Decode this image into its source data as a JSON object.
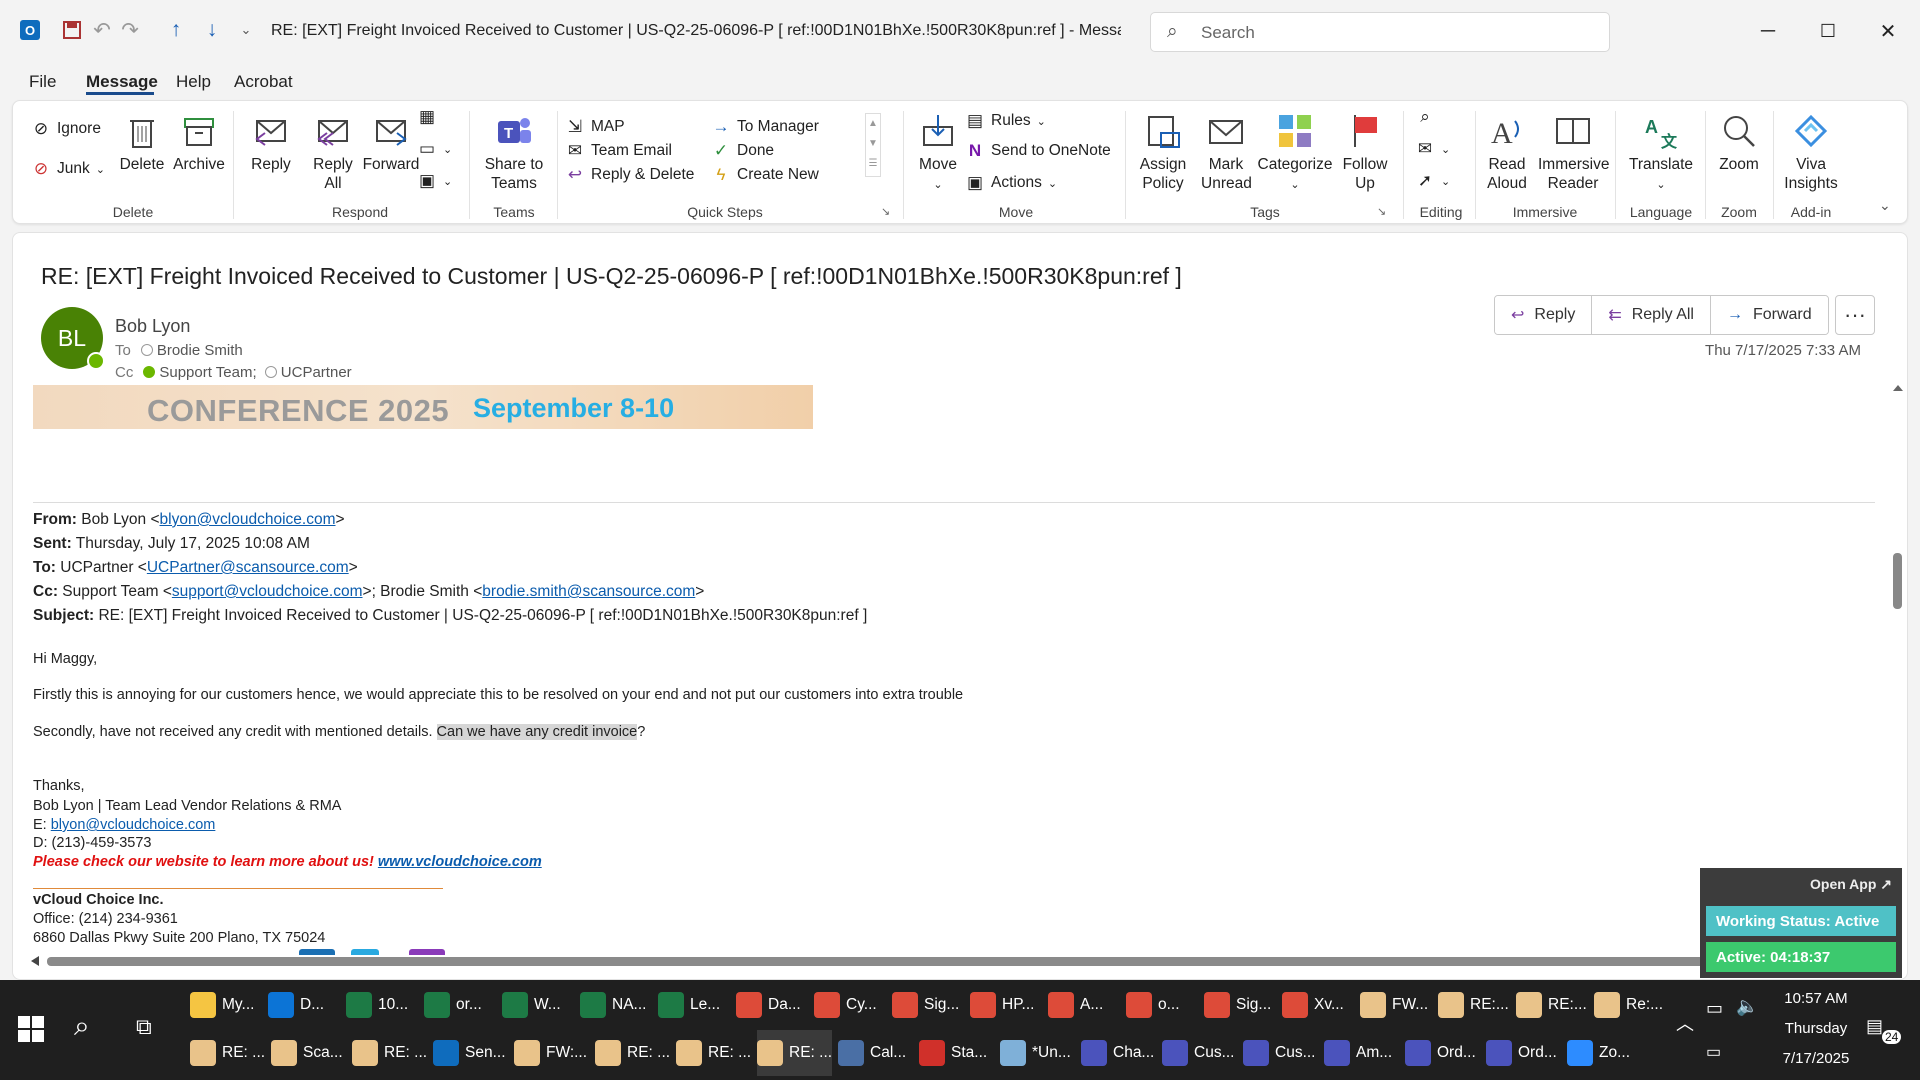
{
  "window": {
    "title": "RE: [EXT] Freight Invoiced Received to Customer | US-Q2-25-06096-P    [ ref:!00D1N01BhXe.!500R30K8pun:ref ]  -  Message (HT...",
    "search_placeholder": "Search"
  },
  "menu": {
    "file": "File",
    "message": "Message",
    "help": "Help",
    "acrobat": "Acrobat"
  },
  "ribbon": {
    "ignore": "Ignore",
    "junk": "Junk",
    "delete": "Delete",
    "archive": "Archive",
    "reply": "Reply",
    "reply_all": "Reply All",
    "forward": "Forward",
    "share_to_teams": "Share to Teams",
    "qs_map": "MAP",
    "qs_team_email": "Team Email",
    "qs_reply_delete": "Reply & Delete",
    "qs_to_manager": "To Manager",
    "qs_done": "Done",
    "qs_create_new": "Create New",
    "move": "Move",
    "rules": "Rules",
    "send_onenote": "Send to OneNote",
    "actions": "Actions",
    "assign_policy": "Assign Policy",
    "mark_unread": "Mark Unread",
    "categorize": "Categorize",
    "follow_up": "Follow Up",
    "read_aloud": "Read Aloud",
    "immersive_reader": "Immersive Reader",
    "translate": "Translate",
    "zoom": "Zoom",
    "viva_insights": "Viva Insights",
    "groups": {
      "delete": "Delete",
      "respond": "Respond",
      "teams": "Teams",
      "quick_steps": "Quick Steps",
      "move": "Move",
      "tags": "Tags",
      "editing": "Editing",
      "immersive": "Immersive",
      "language": "Language",
      "zoom": "Zoom",
      "addin": "Add-in"
    }
  },
  "message": {
    "subject": "RE: [EXT] Freight Invoiced Received to Customer | US-Q2-25-06096-P    [ ref:!00D1N01BhXe.!500R30K8pun:ref ]",
    "avatar": "BL",
    "sender": "Bob Lyon",
    "to_label": "To",
    "to": "Brodie Smith",
    "cc_label": "Cc",
    "cc1": "Support Team;",
    "cc2": "UCPartner",
    "btn_reply": "Reply",
    "btn_reply_all": "Reply All",
    "btn_forward": "Forward",
    "btn_more": "···",
    "date": "Thu 7/17/2025 7:33 AM",
    "banner_left": "CONFERENCE 2025",
    "banner_right": "September 8-10"
  },
  "header": {
    "from_label": "From:",
    "from_name": "Bob Lyon <",
    "from_email": "blyon@vcloudchoice.com",
    "from_end": ">",
    "sent_label": "Sent:",
    "sent": "Thursday, July 17, 2025 10:08 AM",
    "to_label": "To:",
    "to_name": "UCPartner <",
    "to_email": "UCPartner@scansource.com",
    "to_end": ">",
    "cc_label": "Cc:",
    "cc_name": "Support Team <",
    "cc_email": "support@vcloudchoice.com",
    "cc_mid": ">; Brodie Smith <",
    "cc_email2": "brodie.smith@scansource.com",
    "cc_end": ">",
    "subject_label": "Subject:",
    "subject": "RE: [EXT] Freight Invoiced Received to Customer | US-Q2-25-06096-P [ ref:!00D1N01BhXe.!500R30K8pun:ref ]"
  },
  "body": {
    "greeting": "Hi Maggy,",
    "p1": "Firstly this is annoying for our customers hence, we would appreciate this to be resolved on your end and not put our customers into extra trouble",
    "p2a": "Secondly, have not received any credit with mentioned details. ",
    "p2b": "Can we have any credit invoice",
    "p2c": "?",
    "thanks": "Thanks,",
    "sig_name": "Bob Lyon | Team Lead Vendor Relations & RMA",
    "sig_e_label": "E: ",
    "sig_email": "blyon@vcloudchoice.com",
    "sig_phone": "D: (213)-459-3573",
    "promo": "Please check our website to learn more about us! ",
    "promo_link": "www.vcloudchoice.com",
    "company": "vCloud Choice Inc.",
    "office": "Office: (214) 234-9361",
    "address": "6860 Dallas Pkwy Suite 200 Plano, TX 75024"
  },
  "working_status": {
    "open_app": "Open App ↗",
    "status": "Working Status: Active",
    "active": "Active: 04:18:37"
  },
  "taskbar": {
    "row1": [
      "My...",
      "D...",
      "10...",
      "or...",
      "W...",
      "NA...",
      "Le...",
      "Da...",
      "Cy...",
      "Sig...",
      "HP...",
      "A...",
      "o...",
      "Sig...",
      "Xv...",
      "FW...",
      "RE:...",
      "RE:...",
      "Re:..."
    ],
    "row2": [
      "RE: ...",
      "Sca...",
      "RE: ...",
      "Sen...",
      "FW:...",
      "RE: ...",
      "RE: ...",
      "RE: ...",
      "Cal...",
      "Sta...",
      "*Un...",
      "Cha...",
      "Cus...",
      "Cus...",
      "Am...",
      "Ord...",
      "Ord...",
      "Zo..."
    ],
    "time": "10:57 AM",
    "day": "Thursday",
    "date": "7/17/2025",
    "notif_count": "24"
  },
  "colors": {
    "accent": "#1a4b8c",
    "avatar": "#498205",
    "link": "#0b5cad",
    "promo": "#e01010",
    "taskbar": "#1f1f1f"
  }
}
